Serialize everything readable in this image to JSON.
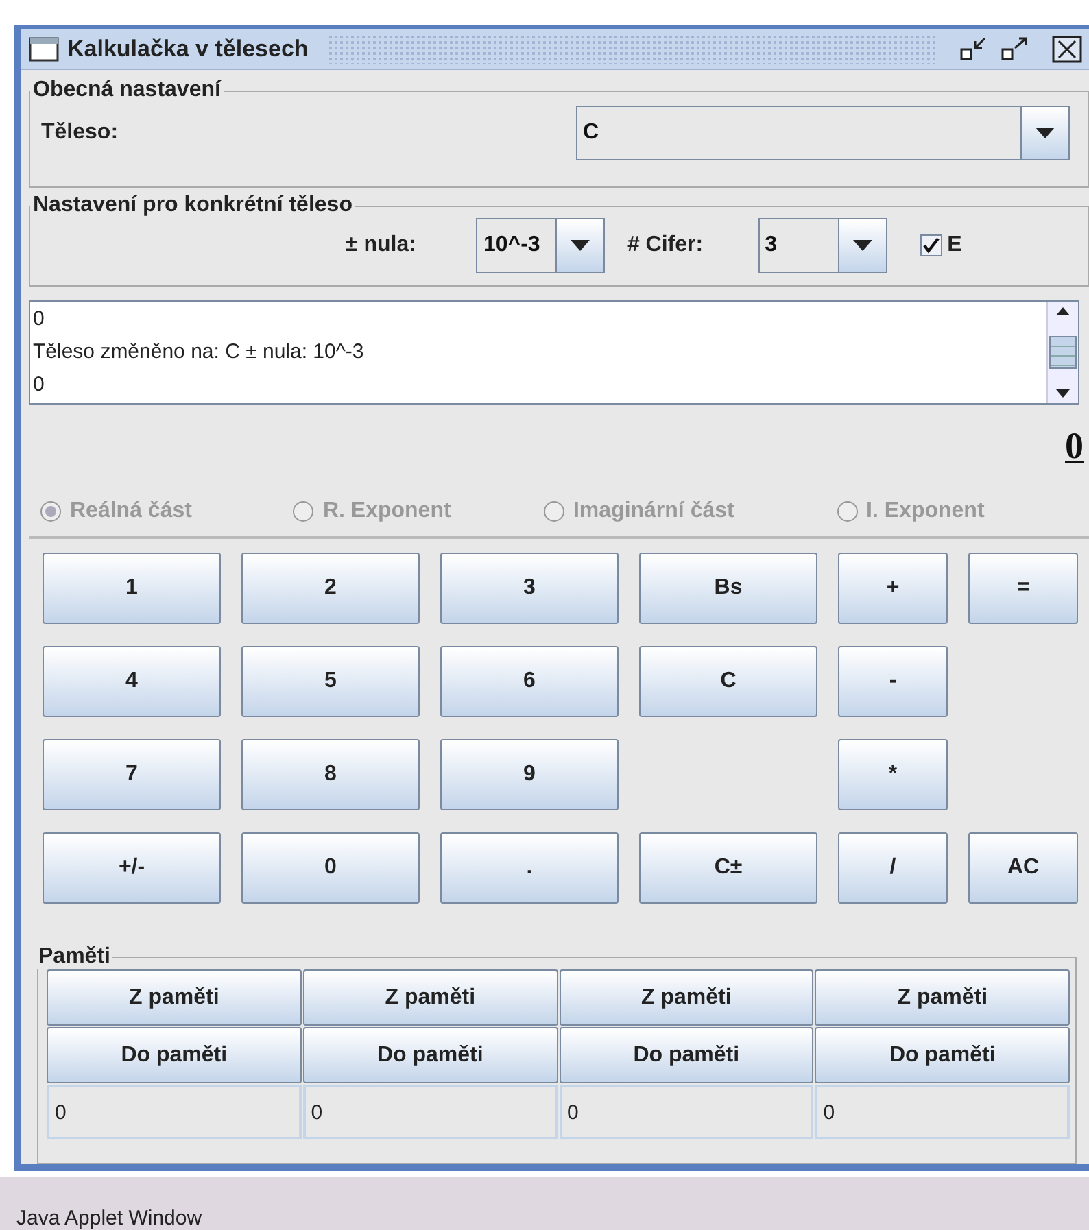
{
  "window": {
    "title": "Kalkulačka v tělesech"
  },
  "general": {
    "legend": "Obecná nastavení",
    "label": "Těleso:",
    "combo_value": "C"
  },
  "specific": {
    "legend": "Nastavení pro konkrétní těleso",
    "zero_label": "± nula:",
    "zero_value": "10^-3",
    "digits_label": "# Cifer:",
    "digits_value": "3",
    "checkbox": {
      "label": "E",
      "checked": true
    }
  },
  "log": {
    "lines": [
      "0",
      "Těleso změněno na: C ± nula: 10^-3",
      "0"
    ]
  },
  "display": "0",
  "radios": [
    {
      "label": "Reálná část",
      "selected": true,
      "disabled": true
    },
    {
      "label": "R. Exponent",
      "selected": false,
      "disabled": true
    },
    {
      "label": "Imaginární část",
      "selected": false,
      "disabled": true
    },
    {
      "label": "I. Exponent",
      "selected": false,
      "disabled": true
    }
  ],
  "keypad": [
    [
      {
        "kind": "key",
        "label": "1"
      },
      {
        "kind": "key",
        "label": "2"
      },
      {
        "kind": "key",
        "label": "3"
      },
      {
        "kind": "key",
        "label": "Bs"
      },
      {
        "kind": "key",
        "label": "+"
      },
      {
        "kind": "key",
        "label": "="
      }
    ],
    [
      {
        "kind": "key",
        "label": "4"
      },
      {
        "kind": "key",
        "label": "5"
      },
      {
        "kind": "key",
        "label": "6"
      },
      {
        "kind": "key",
        "label": "C"
      },
      {
        "kind": "key",
        "label": "-"
      },
      {
        "kind": "blank"
      }
    ],
    [
      {
        "kind": "key",
        "label": "7"
      },
      {
        "kind": "key",
        "label": "8"
      },
      {
        "kind": "key",
        "label": "9"
      },
      {
        "kind": "blank"
      },
      {
        "kind": "key",
        "label": "*"
      },
      {
        "kind": "blank"
      }
    ],
    [
      {
        "kind": "key",
        "label": "+/-"
      },
      {
        "kind": "key",
        "label": "0"
      },
      {
        "kind": "key",
        "label": "."
      },
      {
        "kind": "key",
        "label": "C±"
      },
      {
        "kind": "key",
        "label": "/"
      },
      {
        "kind": "key",
        "label": "AC"
      }
    ]
  ],
  "memory": {
    "legend": "Paměti",
    "slots": [
      {
        "recall": "Z paměti",
        "store": "Do paměti",
        "value": "0"
      },
      {
        "recall": "Z paměti",
        "store": "Do paměti",
        "value": "0"
      },
      {
        "recall": "Z paměti",
        "store": "Do paměti",
        "value": "0"
      },
      {
        "recall": "Z paměti",
        "store": "Do paměti",
        "value": "0"
      }
    ]
  },
  "status_bar": "Java Applet Window"
}
